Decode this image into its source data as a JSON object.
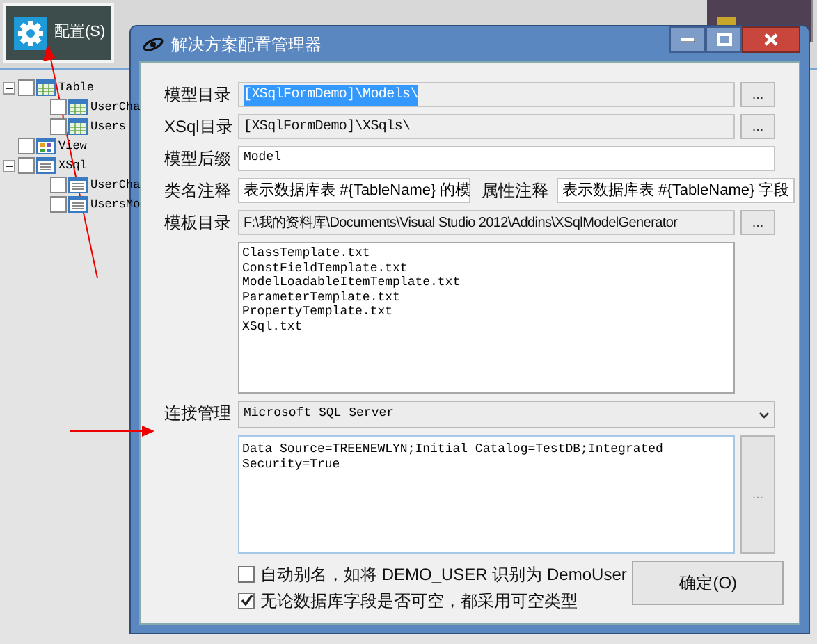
{
  "config_button": {
    "label": "配置(S)"
  },
  "tree": [
    {
      "label": "Table",
      "kind": "table",
      "checked": false,
      "expanded": true,
      "children": [
        {
          "label": "UserCha",
          "kind": "table",
          "checked": false
        },
        {
          "label": "Users",
          "kind": "table",
          "checked": false
        }
      ]
    },
    {
      "label": "View",
      "kind": "view",
      "checked": false
    },
    {
      "label": "XSql",
      "kind": "list",
      "checked": false,
      "expanded": true,
      "children": [
        {
          "label": "UserCha",
          "kind": "list",
          "checked": false
        },
        {
          "label": "UsersMo",
          "kind": "list",
          "checked": false
        }
      ]
    }
  ],
  "dialog": {
    "title": "解决方案配置管理器",
    "rows": [
      {
        "kind": "path",
        "label": "模型目录",
        "value": "[XSqlFormDemo]\\Models\\",
        "selected": true,
        "button": "..."
      },
      {
        "kind": "path",
        "label": "XSql目录",
        "value": "[XSqlFormDemo]\\XSqls\\",
        "selected": false,
        "button": "..."
      },
      {
        "kind": "text",
        "label": "模型后缀",
        "value": "Model"
      },
      {
        "kind": "pair",
        "label": "类名注释",
        "value": "表示数据库表 #{TableName} 的模",
        "label_2": "属性注释",
        "value_2": "表示数据库表 #{TableName} 字段"
      },
      {
        "kind": "path",
        "label": "模板目录",
        "value": "F:\\我的资料库\\Documents\\Visual Studio 2012\\Addins\\XSqlModelGenerator",
        "selected": false,
        "button": "..."
      },
      {
        "kind": "list",
        "items": [
          "ClassTemplate.txt",
          "ConstFieldTemplate.txt",
          "ModelLoadableItemTemplate.txt",
          "ParameterTemplate.txt",
          "PropertyTemplate.txt",
          "XSql.txt"
        ]
      },
      {
        "kind": "combo",
        "label": "连接管理",
        "value": "Microsoft_SQL_Server"
      },
      {
        "kind": "memo",
        "value": "Data Source=TREENEWLYN;Initial Catalog=TestDB;Integrated Security=True",
        "button": "..."
      }
    ],
    "options": [
      {
        "label": "自动别名，如将 DEMO_USER 识别为 DemoUser",
        "checked": false
      },
      {
        "label": "无论数据库字段是否可空，都采用可空类型",
        "checked": true
      }
    ],
    "ok_button": "确定(O)"
  }
}
